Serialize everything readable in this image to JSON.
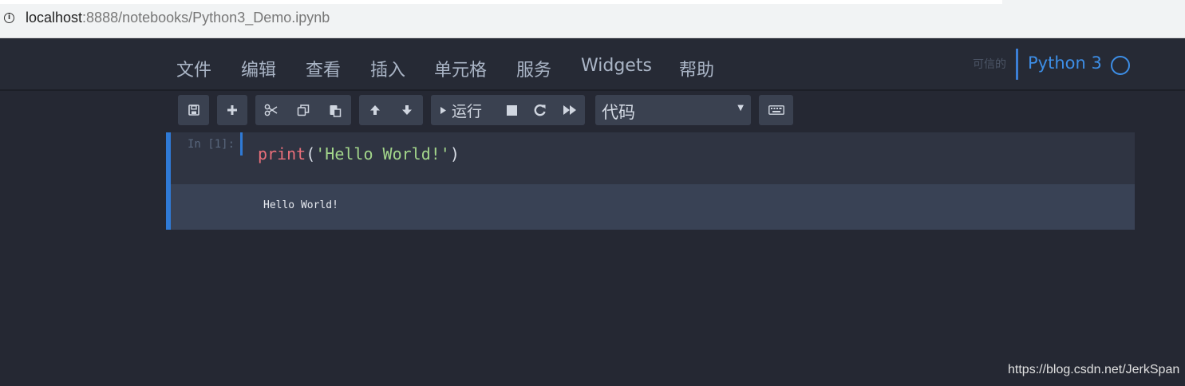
{
  "browser": {
    "url_host": "localhost",
    "url_path": ":8888/notebooks/Python3_Demo.ipynb",
    "info_icon": "info-icon"
  },
  "menu": {
    "items": [
      "文件",
      "编辑",
      "查看",
      "插入",
      "单元格",
      "服务",
      "Widgets",
      "帮助"
    ]
  },
  "kernel": {
    "trusted_label": "可信的",
    "name": "Python 3",
    "status_icon": "kernel-idle-circle-icon"
  },
  "toolbar": {
    "run_label": "运行",
    "cell_type_selected": "代码",
    "icons": [
      "save-icon",
      "plus-icon",
      "cut-icon",
      "copy-icon",
      "paste-icon",
      "arrow-up-icon",
      "arrow-down-icon",
      "run-icon",
      "stop-icon",
      "restart-icon",
      "fast-forward-icon",
      "keyboard-icon"
    ]
  },
  "cell": {
    "prompt": "In [1]:",
    "code_func": "print",
    "code_open": "(",
    "code_string": "'Hello World!'",
    "code_close": ")",
    "output": "Hello World!"
  },
  "watermark": "https://blog.csdn.net/JerkSpan",
  "colors": {
    "background": "#252833",
    "accent": "#3d8ee6",
    "cell_selected_bar": "#2f7ad6"
  }
}
